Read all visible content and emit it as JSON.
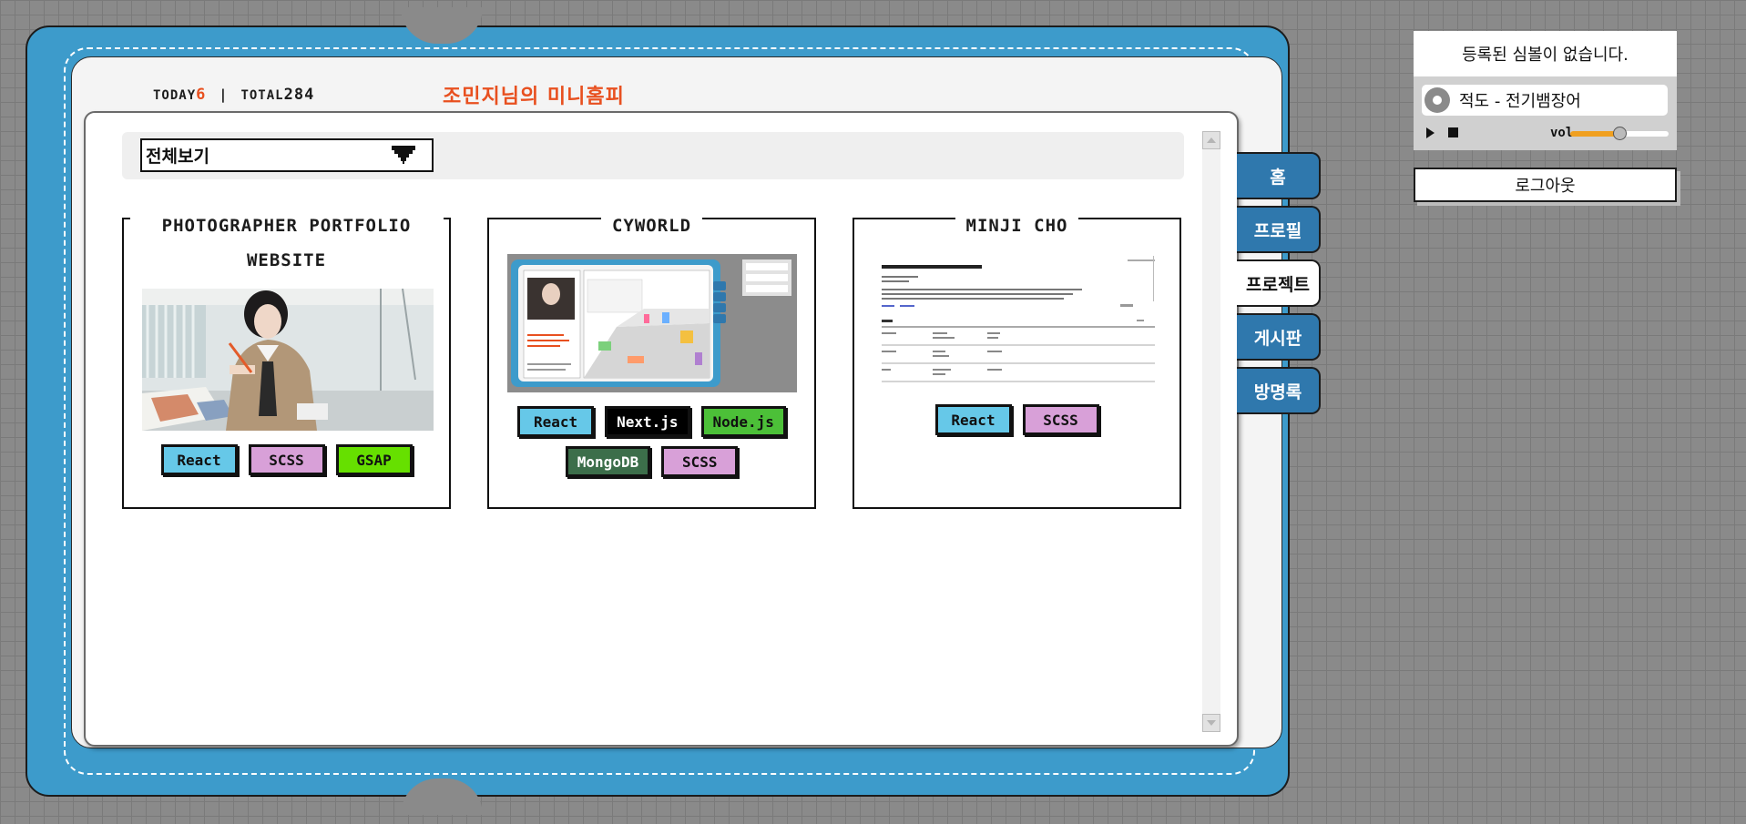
{
  "header": {
    "today_label": "TODAY",
    "today_count": "6",
    "total_label": "TOTAL",
    "total_count": "284",
    "title": "조민지님의 미니홈피"
  },
  "filter": {
    "selected": "전체보기"
  },
  "projects": [
    {
      "title": "PHOTOGRAPHER PORTFOLIO WEBSITE",
      "tags": [
        {
          "label": "React",
          "bg": "#66c8e8",
          "fg": "#111111"
        },
        {
          "label": "SCSS",
          "bg": "#d8a0d8",
          "fg": "#111111"
        },
        {
          "label": "GSAP",
          "bg": "#66e000",
          "fg": "#111111"
        }
      ]
    },
    {
      "title": "CYWORLD",
      "tags": [
        {
          "label": "React",
          "bg": "#66c8e8",
          "fg": "#111111"
        },
        {
          "label": "Next.js",
          "bg": "#000000",
          "fg": "#ffffff"
        },
        {
          "label": "Node.js",
          "bg": "#4cc038",
          "fg": "#111111"
        },
        {
          "label": "MongoDB",
          "bg": "#3c6e4a",
          "fg": "#ffffff"
        },
        {
          "label": "SCSS",
          "bg": "#d8a0d8",
          "fg": "#111111"
        }
      ]
    },
    {
      "title": "MINJI CHO",
      "tags": [
        {
          "label": "React",
          "bg": "#66c8e8",
          "fg": "#111111"
        },
        {
          "label": "SCSS",
          "bg": "#d8a0d8",
          "fg": "#111111"
        }
      ]
    }
  ],
  "nav": {
    "items": [
      "홈",
      "프로필",
      "프로젝트",
      "게시판",
      "방명록"
    ],
    "active": "프로젝트"
  },
  "widget": {
    "symbol_text": "등록된 심볼이 없습니다.",
    "song_title": "적도 - 전기뱀장어",
    "volume_label": "vol",
    "volume_level": 0.5
  },
  "logout_label": "로그아웃",
  "colors": {
    "book_blue": "#3d9bcb",
    "nav_blue": "#2f78ad",
    "title_orange": "#e8501f",
    "volume_orange": "#f0a020"
  },
  "icons": {
    "filter_dropdown": "pixel-arrow-down-icon",
    "scroll_up": "triangle-up-icon",
    "scroll_down": "triangle-down-icon",
    "player_cd": "cd-icon",
    "play": "play-icon",
    "stop": "stop-icon"
  }
}
